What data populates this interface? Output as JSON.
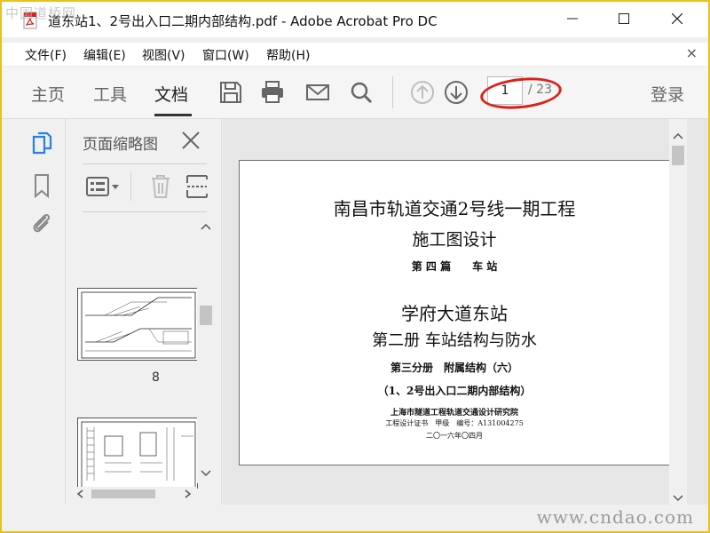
{
  "window": {
    "title": "道东站1、2号出入口二期内部结构.pdf - Adobe Acrobat Pro DC",
    "watermark_top": "中国道桥网",
    "watermark_bottom": "www.cndao.com"
  },
  "menu": {
    "items": [
      "文件(F)",
      "编辑(E)",
      "视图(V)",
      "窗口(W)",
      "帮助(H)"
    ],
    "close_glyph": "×"
  },
  "toolbar": {
    "tabs": [
      "主页",
      "工具",
      "文档"
    ],
    "active_tab": "文档",
    "page_current": "1",
    "page_total": "/ 23",
    "login_label": "登录",
    "icons": [
      "save-icon",
      "print-icon",
      "email-icon",
      "search-icon",
      "page-up-icon",
      "page-down-icon"
    ]
  },
  "thumbnails": {
    "title": "页面缩略图",
    "pages": [
      {
        "label": "8"
      },
      {
        "label": ""
      }
    ]
  },
  "document": {
    "lines": [
      "南昌市轨道交通2号线一期工程",
      "施工图设计",
      "第 四 篇　　车 站",
      "学府大道东站",
      "第二册  车站结构与防水",
      "第三分册　附属结构（六）",
      "（1、2号出入口二期内部结构）",
      "上海市隧道工程轨道交通设计研究院",
      "工程设计证书　甲级　编号：A131004275",
      "二〇一六年〇四月"
    ]
  },
  "colors": {
    "frame": "#e8c21c",
    "annotation_ring": "#d8231c",
    "rail_active_icon": "#2680eb"
  }
}
